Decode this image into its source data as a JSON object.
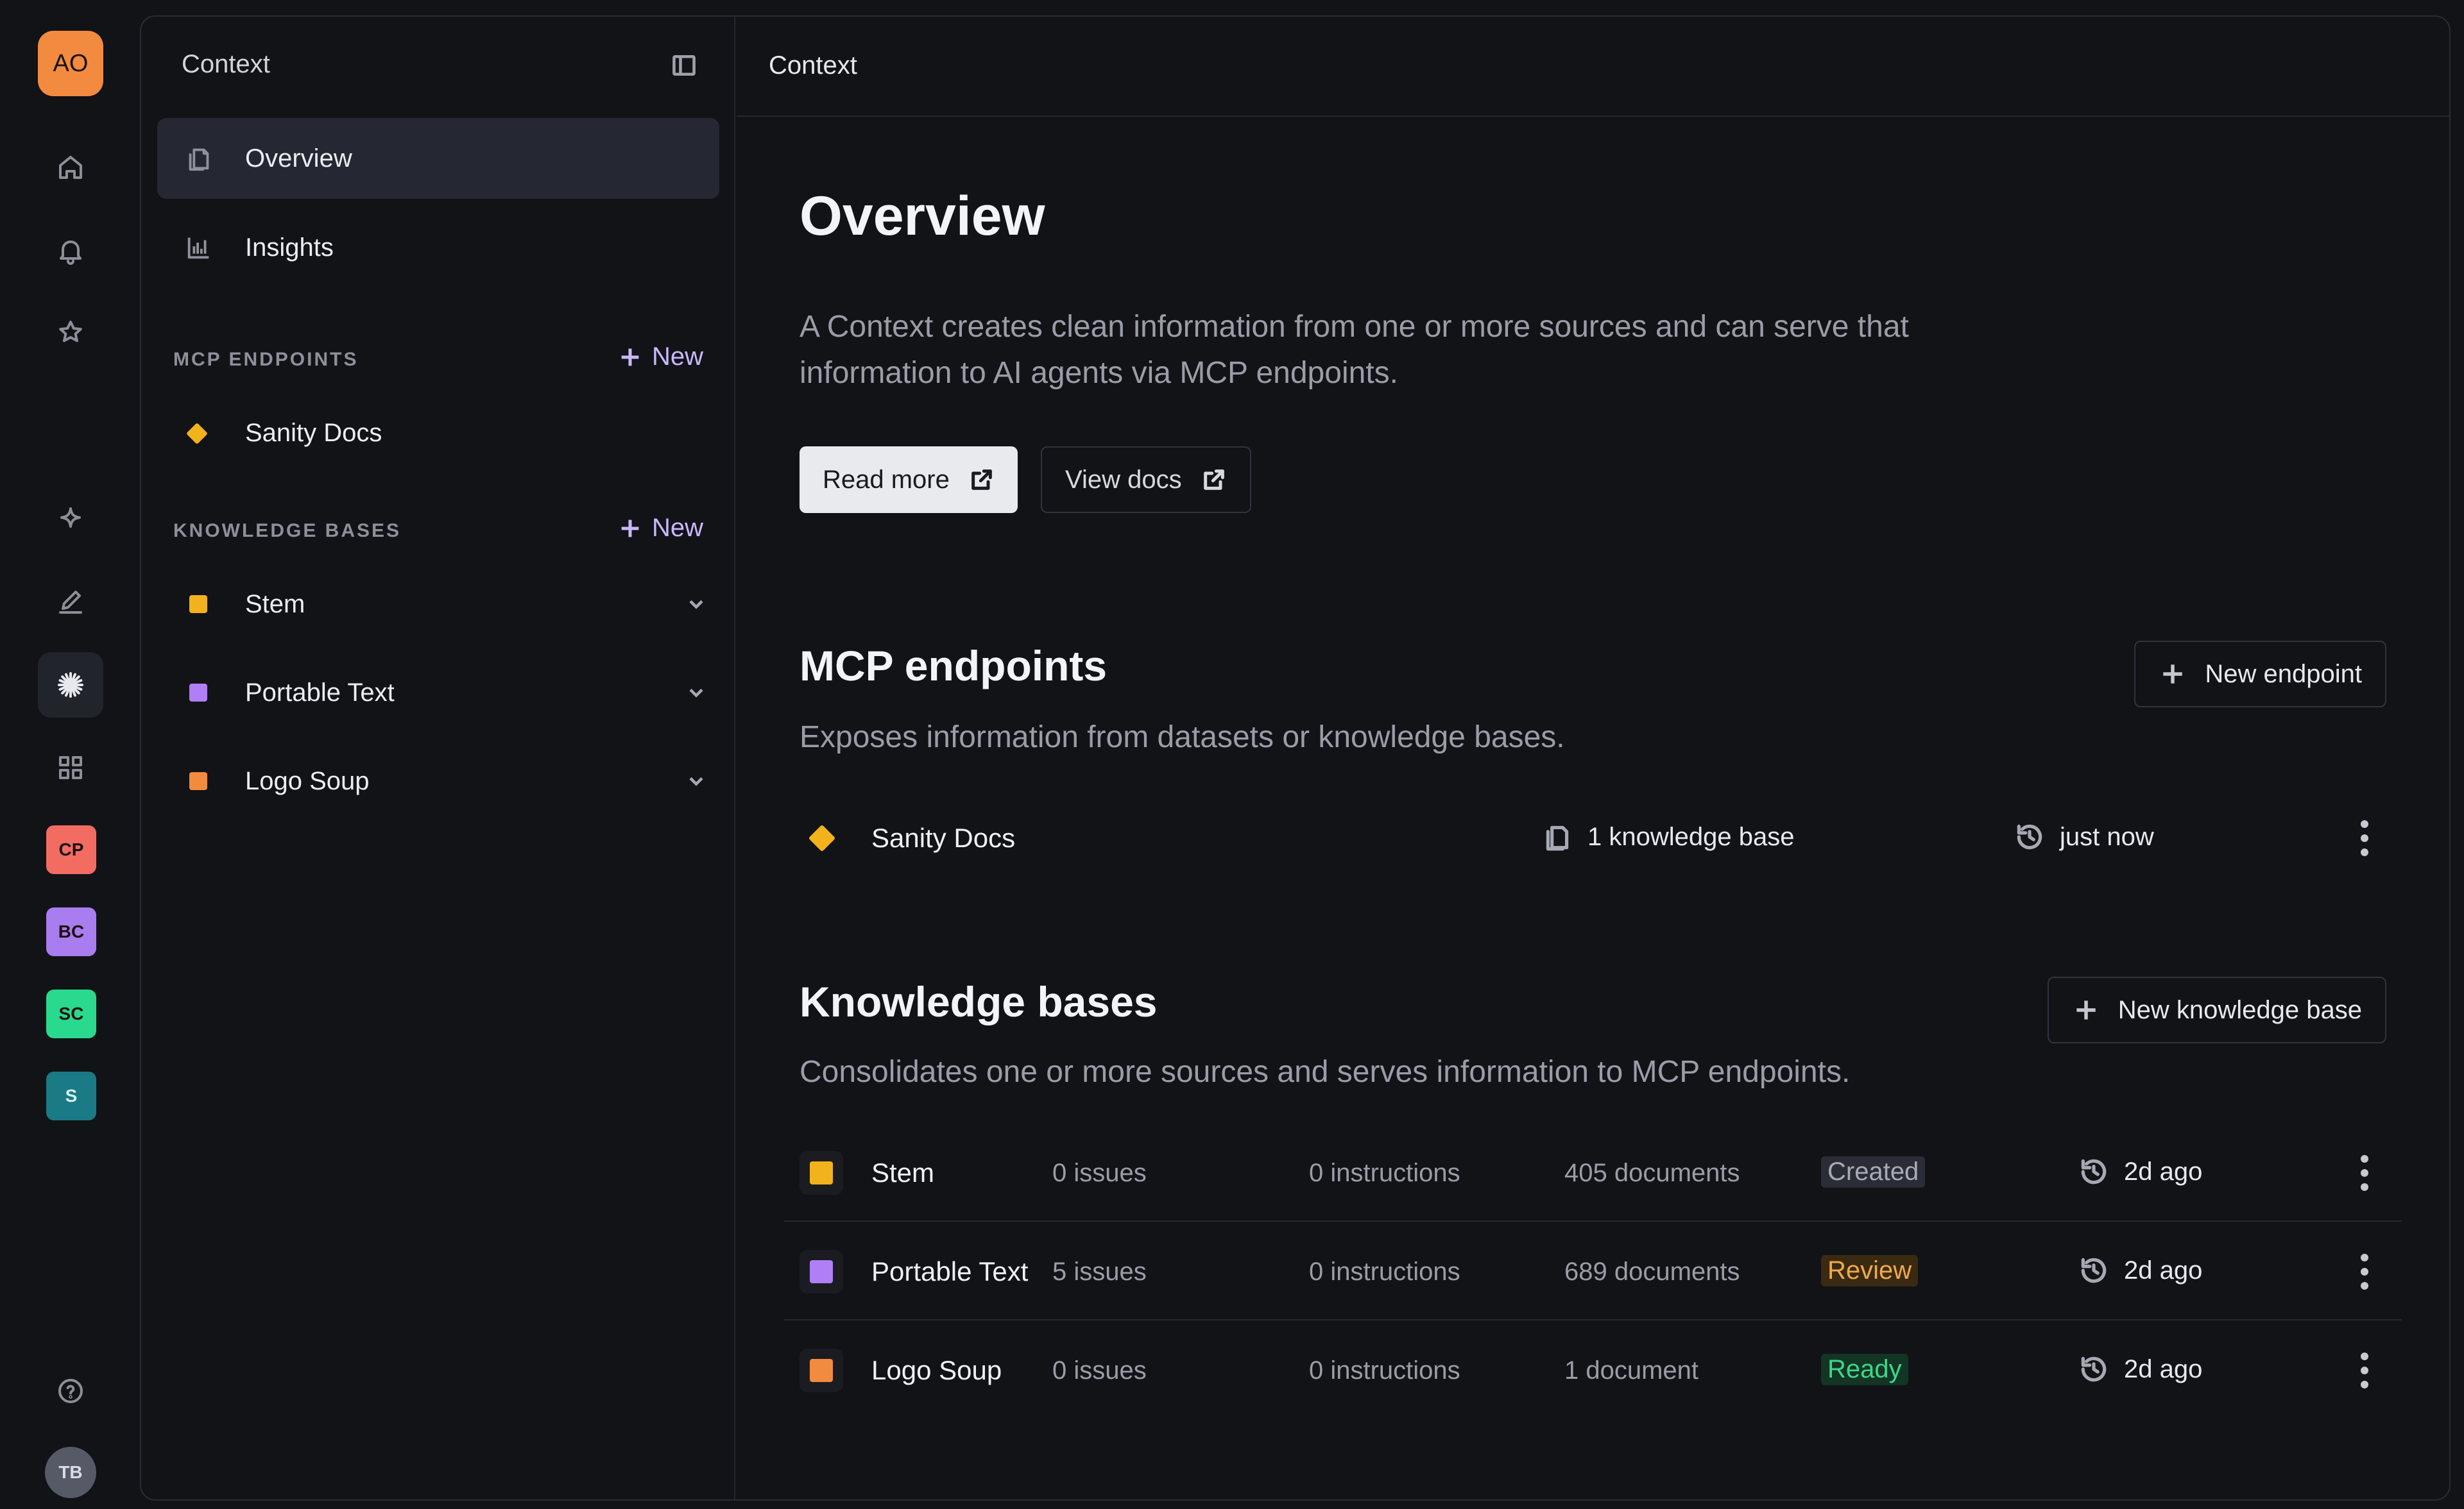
{
  "rail": {
    "workspace_initials": "AO",
    "projects": [
      {
        "initials": "CP",
        "color": "#f26c62"
      },
      {
        "initials": "BC",
        "color": "#a97cf0"
      },
      {
        "initials": "SC",
        "color": "#29d98e"
      },
      {
        "initials": "S",
        "color": "#1a7a86"
      }
    ],
    "user_initials": "TB"
  },
  "nav": {
    "title": "Context",
    "items": [
      {
        "label": "Overview",
        "icon": "documents-icon"
      },
      {
        "label": "Insights",
        "icon": "bar-chart-icon"
      }
    ],
    "mcp_section": {
      "label": "MCP ENDPOINTS",
      "new_label": "New",
      "items": [
        {
          "label": "Sanity Docs",
          "color": "#f2b21b"
        }
      ]
    },
    "kb_section": {
      "label": "KNOWLEDGE BASES",
      "new_label": "New",
      "items": [
        {
          "label": "Stem",
          "color": "#f2b21b"
        },
        {
          "label": "Portable Text",
          "color": "#b07ef5"
        },
        {
          "label": "Logo Soup",
          "color": "#f28b40"
        }
      ]
    }
  },
  "content": {
    "header_title": "Context",
    "title": "Overview",
    "description": "A Context creates clean information from one or more sources and can serve that information to AI agents via MCP endpoints.",
    "read_more_label": "Read more",
    "view_docs_label": "View docs",
    "mcp": {
      "title": "MCP endpoints",
      "subtitle": "Exposes information from datasets or knowledge bases.",
      "new_button": "New endpoint",
      "rows": [
        {
          "name": "Sanity Docs",
          "kb_count": "1 knowledge base",
          "updated": "just now",
          "color": "#f2b21b"
        }
      ]
    },
    "kb": {
      "title": "Knowledge bases",
      "subtitle": "Consolidates one or more sources and serves information to MCP endpoints.",
      "new_button": "New knowledge base",
      "rows": [
        {
          "name": "Stem",
          "issues": "0 issues",
          "instructions": "0 instructions",
          "documents": "405 documents",
          "status": "Created",
          "updated": "2d ago",
          "color": "#f2b21b",
          "status_fg": "#a7abb6",
          "status_bg": "#2a2d36"
        },
        {
          "name": "Portable Text",
          "issues": "5 issues",
          "instructions": "0 instructions",
          "documents": "689 documents",
          "status": "Review",
          "updated": "2d ago",
          "color": "#b07ef5",
          "status_fg": "#f0a94a",
          "status_bg": "#3a2a12"
        },
        {
          "name": "Logo Soup",
          "issues": "0 issues",
          "instructions": "0 instructions",
          "documents": "1 document",
          "status": "Ready",
          "updated": "2d ago",
          "color": "#f28b40",
          "status_fg": "#3ed68a",
          "status_bg": "#123524"
        }
      ]
    }
  }
}
